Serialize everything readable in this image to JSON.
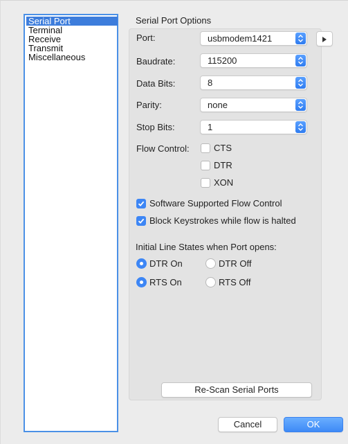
{
  "sidebar": {
    "items": [
      {
        "label": "Serial Port",
        "selected": true
      },
      {
        "label": "Terminal",
        "selected": false
      },
      {
        "label": "Receive",
        "selected": false
      },
      {
        "label": "Transmit",
        "selected": false
      },
      {
        "label": "Miscellaneous",
        "selected": false
      }
    ]
  },
  "options": {
    "title": "Serial Port Options",
    "port": {
      "label": "Port:",
      "value": "usbmodem1421"
    },
    "baudrate": {
      "label": "Baudrate:",
      "value": "115200"
    },
    "data_bits": {
      "label": "Data Bits:",
      "value": "8"
    },
    "parity": {
      "label": "Parity:",
      "value": "none"
    },
    "stop_bits": {
      "label": "Stop Bits:",
      "value": "1"
    },
    "flow_control": {
      "label": "Flow Control:",
      "cts": {
        "label": "CTS",
        "checked": false
      },
      "dtr": {
        "label": "DTR",
        "checked": false
      },
      "xon": {
        "label": "XON",
        "checked": false
      }
    },
    "software_flow": {
      "label": "Software Supported Flow Control",
      "checked": true
    },
    "block_keystrokes": {
      "label": "Block Keystrokes while flow is halted",
      "checked": true
    },
    "line_states": {
      "label": "Initial Line States when Port opens:",
      "dtr_on": {
        "label": "DTR On",
        "selected": true
      },
      "dtr_off": {
        "label": "DTR Off",
        "selected": false
      },
      "rts_on": {
        "label": "RTS On",
        "selected": true
      },
      "rts_off": {
        "label": "RTS Off",
        "selected": false
      }
    },
    "rescan_label": "Re-Scan Serial Ports"
  },
  "footer": {
    "cancel_label": "Cancel",
    "ok_label": "OK"
  },
  "colors": {
    "accent": "#3d86f5",
    "selection": "#3d7ddc",
    "window_bg": "#ececec",
    "group_bg": "#e3e3e3"
  },
  "icons": {
    "select_arrow": "up-down-chevron-icon",
    "side_button": "play-triangle-icon",
    "checkmark": "checkmark-icon"
  }
}
